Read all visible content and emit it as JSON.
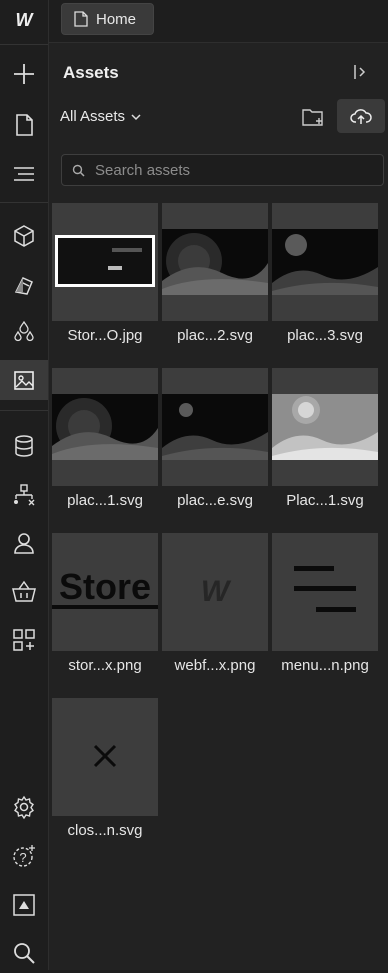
{
  "topbar": {
    "home_label": "Home"
  },
  "rail": {
    "items": [
      {
        "name": "add-icon"
      },
      {
        "name": "pages-icon"
      },
      {
        "name": "navigator-icon"
      },
      {
        "name": "components-icon"
      },
      {
        "name": "style-manager-icon"
      },
      {
        "name": "variables-icon"
      },
      {
        "name": "assets-icon",
        "active": true
      },
      {
        "name": "cms-icon"
      },
      {
        "name": "logic-icon"
      },
      {
        "name": "users-icon"
      },
      {
        "name": "ecommerce-icon"
      },
      {
        "name": "apps-icon"
      },
      {
        "name": "settings-icon"
      },
      {
        "name": "help-icon"
      },
      {
        "name": "video-tutorials-icon"
      },
      {
        "name": "search-icon"
      }
    ]
  },
  "panel": {
    "title": "Assets",
    "filter_label": "All Assets",
    "search_placeholder": "Search assets"
  },
  "assets": [
    {
      "label": "Stor...O.jpg",
      "thumb": "store-page"
    },
    {
      "label": "plac...2.svg",
      "thumb": "placeholder-dark"
    },
    {
      "label": "plac...3.svg",
      "thumb": "placeholder-dark-moon"
    },
    {
      "label": "plac...1.svg",
      "thumb": "placeholder-dark"
    },
    {
      "label": "plac...e.svg",
      "thumb": "placeholder-dark-moon"
    },
    {
      "label": "Plac...1.svg",
      "thumb": "placeholder-light"
    },
    {
      "label": "stor...x.png",
      "thumb": "store-logo",
      "thumb_text": "Store"
    },
    {
      "label": "webf...x.png",
      "thumb": "webflow-logo",
      "thumb_text": "W"
    },
    {
      "label": "menu...n.png",
      "thumb": "menu-lines"
    },
    {
      "label": "clos...n.svg",
      "thumb": "close-x"
    }
  ],
  "colors": {
    "background": "#1e1e1e",
    "panel": "#222222",
    "tile": "#3d3d3d",
    "active": "#3a3a3a"
  }
}
